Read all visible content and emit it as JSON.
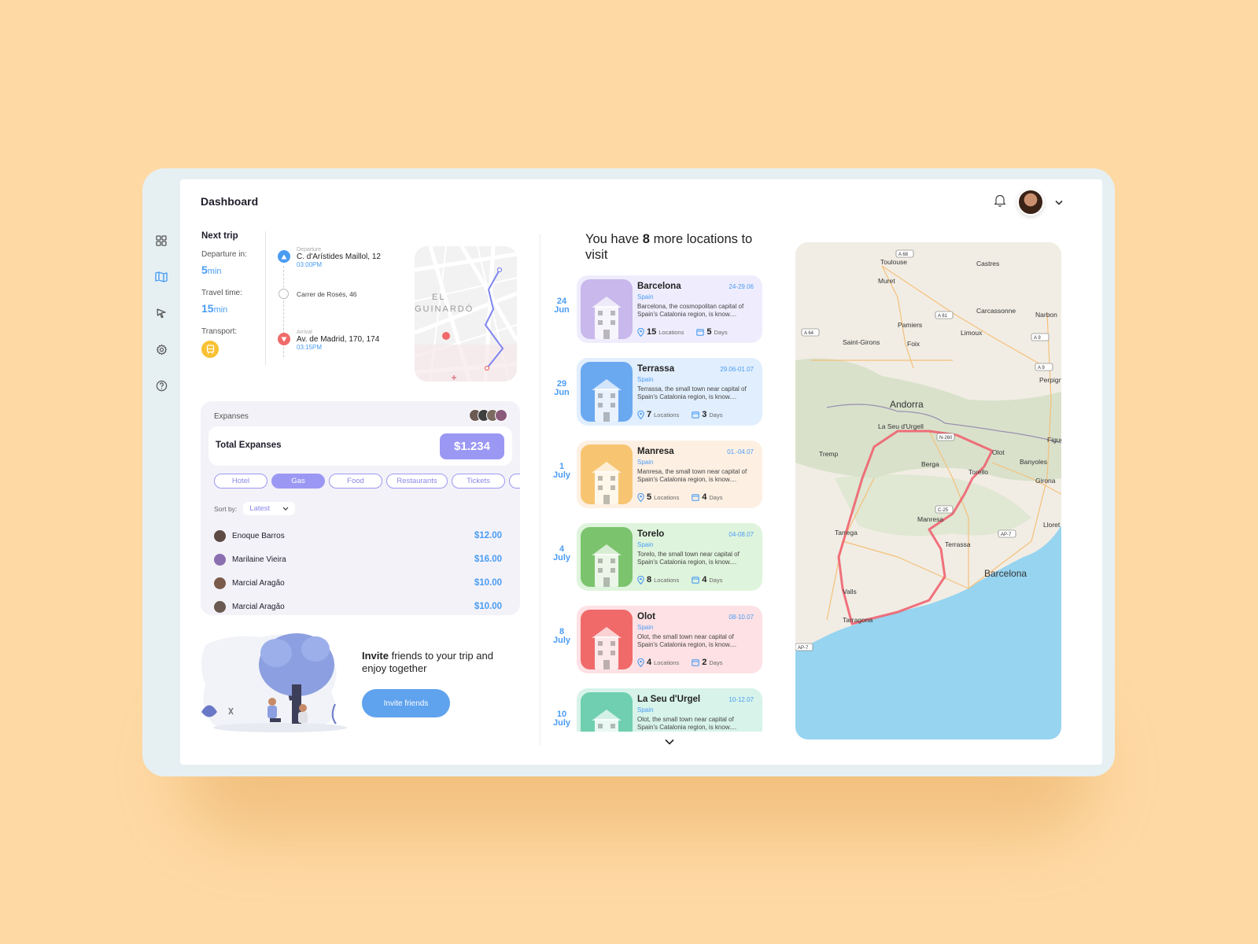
{
  "header": {
    "title": "Dashboard"
  },
  "sidebar": {
    "items": [
      "grid-icon",
      "map-icon",
      "cursor-icon",
      "gear-icon",
      "help-icon"
    ]
  },
  "next_trip": {
    "label": "Next trip",
    "departure_label": "Departure in:",
    "departure_value": "5",
    "departure_unit": "min",
    "travel_label": "Travel time:",
    "travel_value": "15",
    "travel_unit": "min",
    "transport_label": "Transport:",
    "stops": [
      {
        "small": "Departure",
        "address": "C. d'Arístides Maillol, 12",
        "time": "03:00PM"
      },
      {
        "small": "",
        "address": "Carrer de Rosés, 46",
        "time": ""
      },
      {
        "small": "Arrival",
        "address": "Av. de Madrid, 170, 174",
        "time": "03:15PM"
      }
    ],
    "map_text": [
      "EL",
      "GUINARDÓ"
    ]
  },
  "expenses": {
    "header": "Expanses",
    "total_label": "Total Expanses",
    "total_value": "$1.234",
    "chips": [
      "Hotel",
      "Gas",
      "Food",
      "Restaurants",
      "Tickets"
    ],
    "active_chip": "Gas",
    "sort_label": "Sort by:",
    "sort_value": "Latest",
    "rows": [
      {
        "name": "Enoque Barros",
        "amount": "$12.00"
      },
      {
        "name": "Marilaine Vieira",
        "amount": "$16.00"
      },
      {
        "name": "Marcial Aragão",
        "amount": "$10.00"
      },
      {
        "name": "Marcial Aragão",
        "amount": "$10.00"
      }
    ]
  },
  "invite": {
    "bold": "Invite",
    "text": " friends to your trip and enjoy together",
    "button": "Invite friends"
  },
  "locations": {
    "title_pre": "You have ",
    "title_count": "8",
    "title_post": " more locations to visit",
    "items": [
      {
        "day": "24",
        "month": "Jun",
        "name": "Barcelona",
        "dates": "24-29.06",
        "country": "Spain",
        "desc": "Barcelona, the cosmopolitan capital of Spain's Catalonia region, is know....",
        "locations": "15",
        "locations_label": "Locations",
        "days": "5",
        "days_label": "Days",
        "bg": "#efedfd",
        "thumb": "#c8b8ec"
      },
      {
        "day": "29",
        "month": "Jun",
        "name": "Terrassa",
        "dates": "29.06-01.07",
        "country": "Spain",
        "desc": "Terrassa, the small town near capital of Spain's Catalonia region, is know....",
        "locations": "7",
        "locations_label": "Locations",
        "days": "3",
        "days_label": "Days",
        "bg": "#e1eefd",
        "thumb": "#6aa8f0"
      },
      {
        "day": "1",
        "month": "July",
        "name": "Manresa",
        "dates": "01.-04.07",
        "country": "Spain",
        "desc": "Manresa, the small town near capital of Spain's Catalonia region, is know....",
        "locations": "5",
        "locations_label": "Locations",
        "days": "4",
        "days_label": "Days",
        "bg": "#fdf0e3",
        "thumb": "#f7c572"
      },
      {
        "day": "4",
        "month": "July",
        "name": "Torelo",
        "dates": "04-08.07",
        "country": "Spain",
        "desc": "Torelo, the small town near capital of Spain's Catalonia region, is know....",
        "locations": "8",
        "locations_label": "Locations",
        "days": "4",
        "days_label": "Days",
        "bg": "#dff4dc",
        "thumb": "#7cc36e"
      },
      {
        "day": "8",
        "month": "July",
        "name": "Olot",
        "dates": "08-10.07",
        "country": "Spain",
        "desc": "Olot, the small town near capital of Spain's Catalonia region, is know....",
        "locations": "4",
        "locations_label": "Locations",
        "days": "2",
        "days_label": "Days",
        "bg": "#fde1e4",
        "thumb": "#f06a6a"
      },
      {
        "day": "10",
        "month": "July",
        "name": "La Seu d'Urgel",
        "dates": "10-12.07",
        "country": "Spain",
        "desc": "Olot, the small town near capital of Spain's Catalonia region, is know....",
        "locations": "",
        "locations_label": "",
        "days": "",
        "days_label": "",
        "bg": "#d7f3ea",
        "thumb": "#6fcfb0"
      }
    ]
  },
  "map": {
    "labels": [
      "Toulouse",
      "Castres",
      "Muret",
      "Carcassonne",
      "Narbon",
      "Pamiers",
      "Limoux",
      "Saint-Girons",
      "Foix",
      "Perpignan",
      "Andorra",
      "La Seu d'Urgell",
      "Tremp",
      "Berga",
      "Olot",
      "Banyoles",
      "Figue",
      "Torello",
      "Girona",
      "Manresa",
      "Lloret de M",
      "Tarrega",
      "Terrassa",
      "Barcelona",
      "Valls",
      "Tarragona"
    ],
    "roads": [
      "A 68",
      "A 61",
      "A 64",
      "A 9",
      "A 9",
      "N-260",
      "C-25",
      "AP-7",
      "AP-7"
    ]
  },
  "colors": {
    "accent": "#4a9cf3",
    "purple": "#9b98f4",
    "route": "#f05a6a",
    "sea": "#96d4f0"
  }
}
